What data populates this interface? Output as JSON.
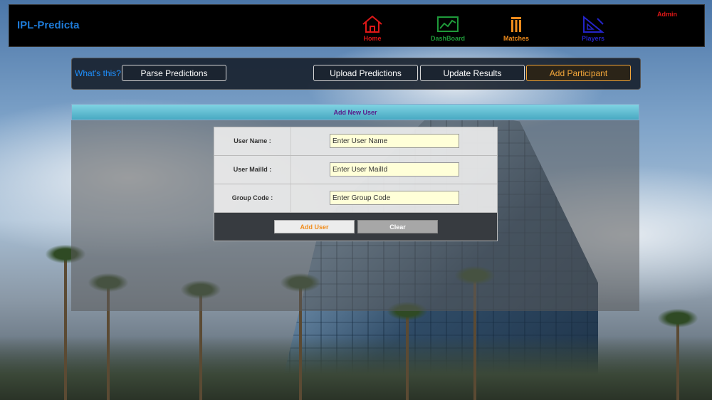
{
  "app": {
    "brand": "IPL-Predicta",
    "admin_label": "Admin"
  },
  "nav": [
    {
      "label": "Home",
      "icon": "home-icon",
      "color": "#e01818"
    },
    {
      "label": "DashBoard",
      "icon": "chart-icon",
      "color": "#1f9a3a"
    },
    {
      "label": "Matches",
      "icon": "stumps-icon",
      "color": "#f08c1c"
    },
    {
      "label": "Players",
      "icon": "set-square-icon",
      "color": "#2424c8"
    }
  ],
  "actions": {
    "whats_this": "What's this?",
    "parse": "Parse Predictions",
    "upload": "Upload Predictions",
    "update": "Update Results",
    "add_participant": "Add Participant"
  },
  "panel": {
    "title": "Add New User"
  },
  "form": {
    "username": {
      "label": "User Name :",
      "placeholder": "Enter User Name"
    },
    "mail": {
      "label": "User MailId :",
      "placeholder": "Enter User MailId"
    },
    "group": {
      "label": "Group Code :",
      "placeholder": "Enter Group Code"
    },
    "add_button": "Add User",
    "clear_button": "Clear"
  },
  "colors": {
    "accent": "#1e7bd8",
    "orange": "#f4a73a",
    "header_text": "#5a1a8a"
  }
}
